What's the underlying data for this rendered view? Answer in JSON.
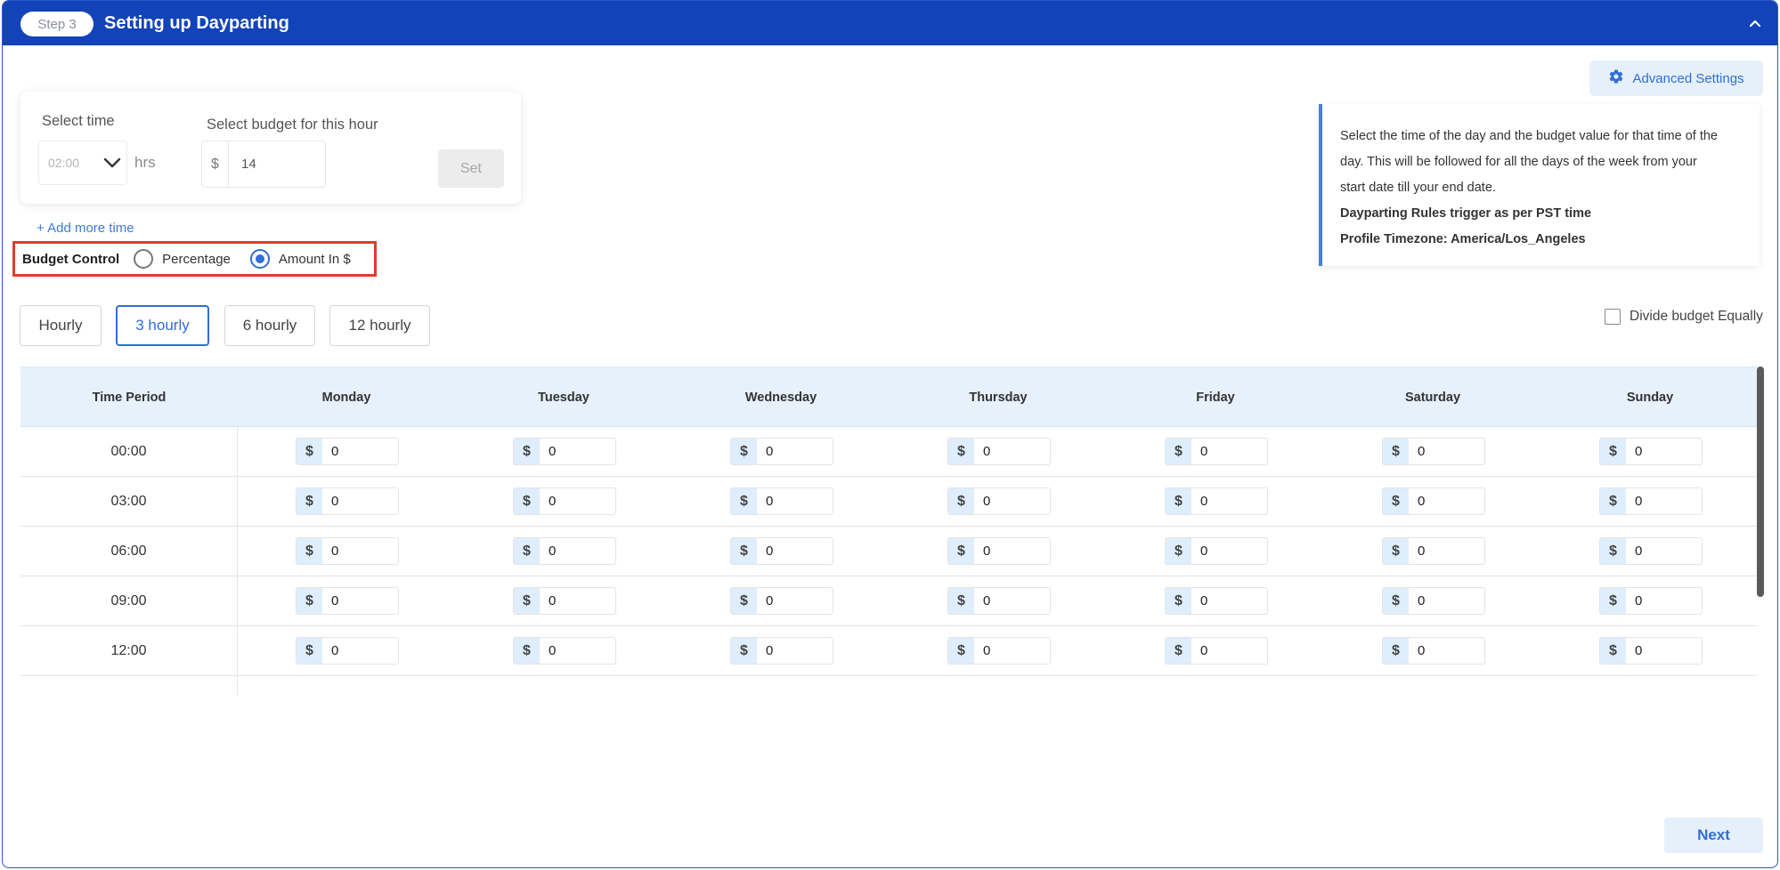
{
  "header": {
    "step_label": "Step 3",
    "title": "Setting up Dayparting",
    "collapse_icon": "chevron-up-icon"
  },
  "advanced_settings": {
    "label": "Advanced Settings",
    "icon": "gear-icon"
  },
  "info": {
    "line1": "Select the time of the day and the budget value for that time of the",
    "line2": "day. This will be followed for all the days of the week from your",
    "line3": "start date till your end date.",
    "rule_trigger": "Dayparting Rules trigger as per PST time",
    "timezone": "Profile Timezone: America/Los_Angeles"
  },
  "time_selector": {
    "time_label": "Select time",
    "time_value": "02:00",
    "hrs_label": "hrs",
    "budget_label": "Select budget for this hour",
    "currency": "$",
    "budget_value": "14",
    "set_label": "Set"
  },
  "add_more_time": "+ Add more time",
  "budget_control": {
    "label": "Budget Control",
    "options": [
      {
        "label": "Percentage",
        "selected": false
      },
      {
        "label": "Amount In $",
        "selected": true
      }
    ]
  },
  "intervals": [
    {
      "label": "Hourly",
      "active": false
    },
    {
      "label": "3 hourly",
      "active": true
    },
    {
      "label": "6 hourly",
      "active": false
    },
    {
      "label": "12 hourly",
      "active": false
    }
  ],
  "divide_budget": {
    "label": "Divide budget Equally",
    "checked": false
  },
  "table": {
    "headers": [
      "Time Period",
      "Monday",
      "Tuesday",
      "Wednesday",
      "Thursday",
      "Friday",
      "Saturday",
      "Sunday"
    ],
    "currency": "$",
    "rows": [
      {
        "time": "00:00",
        "values": [
          "0",
          "0",
          "0",
          "0",
          "0",
          "0",
          "0"
        ]
      },
      {
        "time": "03:00",
        "values": [
          "0",
          "0",
          "0",
          "0",
          "0",
          "0",
          "0"
        ]
      },
      {
        "time": "06:00",
        "values": [
          "0",
          "0",
          "0",
          "0",
          "0",
          "0",
          "0"
        ]
      },
      {
        "time": "09:00",
        "values": [
          "0",
          "0",
          "0",
          "0",
          "0",
          "0",
          "0"
        ]
      },
      {
        "time": "12:00",
        "values": [
          "0",
          "0",
          "0",
          "0",
          "0",
          "0",
          "0"
        ]
      }
    ]
  },
  "next_label": "Next",
  "colors": {
    "header": "#1243b8",
    "accent": "#2f6fd6",
    "highlight": "#e03c2c"
  }
}
